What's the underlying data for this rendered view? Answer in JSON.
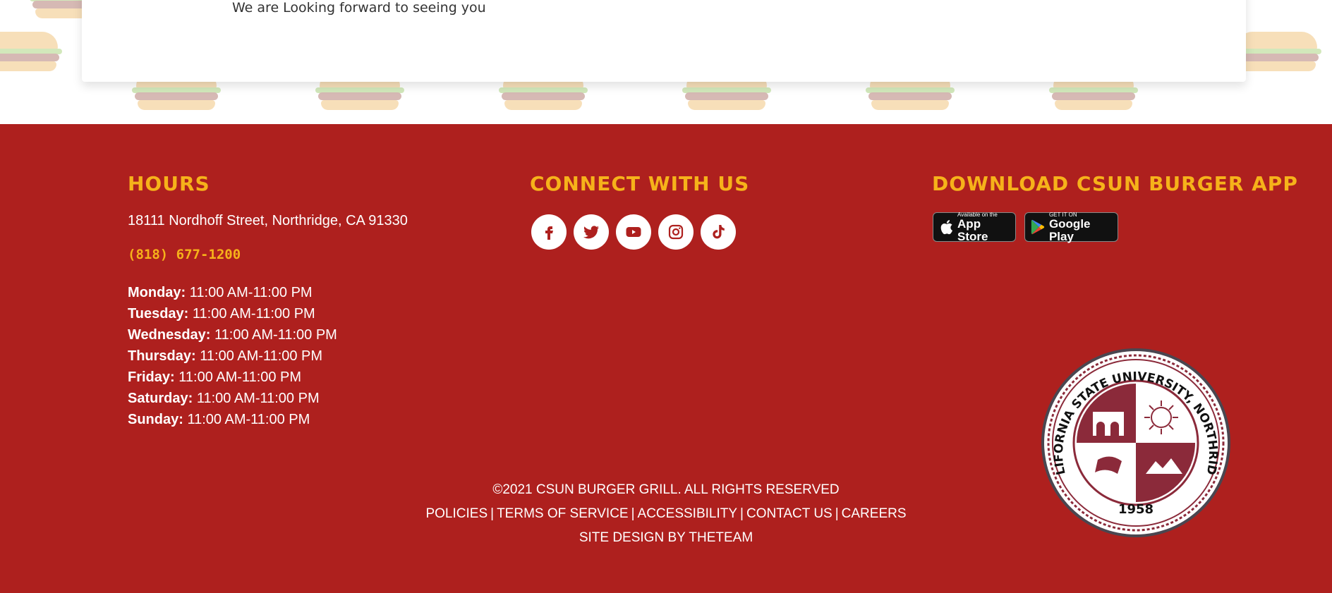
{
  "top": {
    "card_text": "We are Looking forward to seeing you"
  },
  "hours": {
    "title": "HOURS",
    "address": "18111 Nordhoff Street, Northridge, CA 91330",
    "phone": "(818) 677-1200",
    "days": [
      {
        "day": "Monday:",
        "time": "11:00 AM-11:00 PM"
      },
      {
        "day": "Tuesday:",
        "time": "11:00 AM-11:00 PM"
      },
      {
        "day": "Wednesday:",
        "time": "11:00 AM-11:00 PM"
      },
      {
        "day": "Thursday:",
        "time": "11:00 AM-11:00 PM"
      },
      {
        "day": "Friday:",
        "time": "11:00 AM-11:00 PM"
      },
      {
        "day": "Saturday:",
        "time": "11:00 AM-11:00 PM"
      },
      {
        "day": "Sunday:",
        "time": "11:00 AM-11:00 PM"
      }
    ]
  },
  "connect": {
    "title": "CONNECT WITH US",
    "icons": [
      "facebook-icon",
      "twitter-icon",
      "youtube-icon",
      "instagram-icon",
      "tiktok-icon"
    ]
  },
  "download": {
    "title": "DOWNLOAD CSUN BURGER APP",
    "appstore_small": "Available on the",
    "appstore_big": "App Store",
    "googleplay_small": "GET IT ON",
    "googleplay_big": "Google Play"
  },
  "seal": {
    "text_top": "CALIFORNIA STATE UNIVERSITY, NORTHRIDGE",
    "year": "1958"
  },
  "footer": {
    "copyright": "©2021 CSUN BURGER GRILL. ALL RIGHTS RESERVED",
    "links": {
      "policies": "POLICIES",
      "terms": "TERMS OF SERVICE",
      "accessibility": "ACCESSIBILITY",
      "contact": "CONTACT US",
      "careers": "CAREERS"
    },
    "separator": "|",
    "credit": "SITE DESIGN BY THETEAM"
  },
  "colors": {
    "footer_bg": "#ae201e",
    "accent": "#f6b21a"
  }
}
